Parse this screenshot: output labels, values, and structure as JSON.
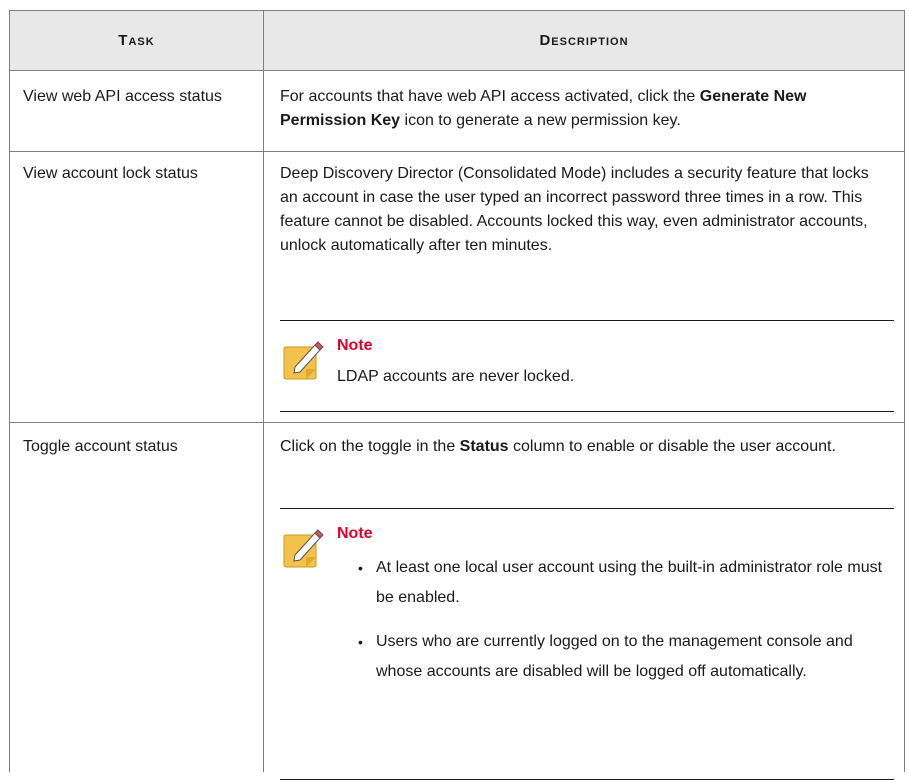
{
  "header": {
    "task": "Task",
    "description": "Description"
  },
  "rows": [
    {
      "task": "View web API access status",
      "desc_pre": "For accounts that have web API access activated, click the ",
      "desc_bold": "Generate New Permission Key",
      "desc_post": " icon to generate a new permission key."
    },
    {
      "task": "View account lock status",
      "desc": "Deep Discovery Director (Consolidated Mode) includes a security feature that locks an account in case the user typed an incorrect password three times in a row. This feature cannot be disabled. Accounts locked this way, even administrator accounts, unlock automatically after ten minutes.",
      "note_title": "Note",
      "note_text": "LDAP accounts are never locked."
    },
    {
      "task": "Toggle account status",
      "desc_pre": "Click on the toggle in the ",
      "desc_bold": "Status",
      "desc_post": " column to enable or disable the user account.",
      "note_title": "Note",
      "note_bullets": [
        "At least one local user account using the built-in administrator role must be enabled.",
        "Users who are currently logged on to the management console and whose accounts are disabled will be logged off automatically."
      ]
    }
  ]
}
